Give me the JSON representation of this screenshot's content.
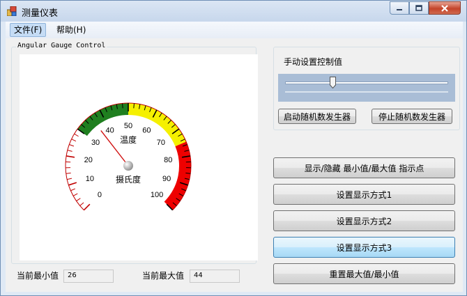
{
  "window": {
    "title": "测量仪表"
  },
  "menu": {
    "file": "文件(F)",
    "help": "帮助(H)"
  },
  "gauge": {
    "group_title": "Angular Gauge Control",
    "label_top": "温度",
    "label_bottom": "摄氏度",
    "scale_min": 0,
    "scale_max": 100,
    "tick_labels": [
      "0",
      "10",
      "20",
      "30",
      "40",
      "50",
      "60",
      "70",
      "80",
      "90",
      "100"
    ],
    "needle_value": 36,
    "ranges": [
      {
        "from": 30,
        "to": 50,
        "color": "#1f7f1f"
      },
      {
        "from": 50,
        "to": 75,
        "color": "#f5f000"
      },
      {
        "from": 75,
        "to": 100,
        "color": "#ee0000"
      }
    ]
  },
  "manual": {
    "label": "手动设置控制值",
    "slider_value": 30
  },
  "buttons": {
    "start_random": "启动随机数发生器",
    "stop_random": "停止随机数发生器",
    "toggle_minmax": "显示/隐藏 最小值/最大值 指示点",
    "mode1": "设置显示方式1",
    "mode2": "设置显示方式2",
    "mode3": "设置显示方式3",
    "reset_minmax": "重置最大值/最小值"
  },
  "stats": {
    "min_label": "当前最小值",
    "min_value": "26",
    "max_label": "当前最大值",
    "max_value": "44"
  }
}
